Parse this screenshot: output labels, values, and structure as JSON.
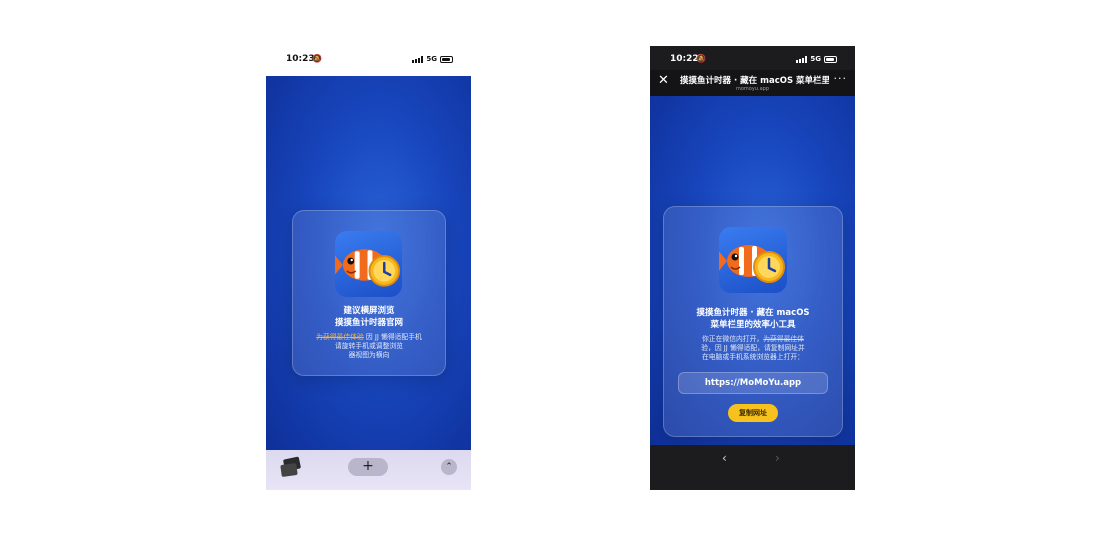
{
  "left_phone": {
    "status_time": "10:23",
    "network": "5G",
    "card": {
      "title_line1": "建议横屏浏览",
      "title_line2": "摸摸鱼计时器官网",
      "body_strike": "为获得最佳体验",
      "body_rest_1": " 因 JJ 懒得适配手机",
      "body_line2": "请旋转手机或调整浏览",
      "body_line3": "器视图为横向"
    },
    "bottom": {
      "plus_label": "+",
      "up_label": "⌃"
    }
  },
  "right_phone": {
    "status_time": "10:22",
    "network": "5G",
    "header": {
      "title": "摸摸鱼计时器 · 藏在 macOS 菜单栏里",
      "domain": "momoyu.app",
      "close_label": "✕",
      "more_label": "···"
    },
    "card": {
      "title_line1": "摸摸鱼计时器 · 藏在 macOS",
      "title_line2": "菜单栏里的效率小工具",
      "body_start": "你正在微信内打开，",
      "body_strike": "为获得最佳体",
      "body_line2": "验，因 JJ 懒得适配，请复制网址并",
      "body_line3": "在电脑或手机系统浏览器上打开：",
      "url": "https://MoMoYu.app",
      "copy_label": "复制网址"
    },
    "bottom": {
      "back_label": "‹",
      "forward_label": "›"
    }
  },
  "colors": {
    "bg_blue": "#1846bd",
    "accent_yellow": "#f7c21d",
    "strike_orange": "#f5b53a"
  },
  "icons": [
    "silent-bell-icon",
    "signal-bars-icon",
    "battery-icon",
    "clownfish-clock-app-icon",
    "tabs-icon",
    "plus-icon",
    "chevron-up-icon",
    "close-icon",
    "more-icon",
    "back-icon",
    "forward-icon"
  ]
}
